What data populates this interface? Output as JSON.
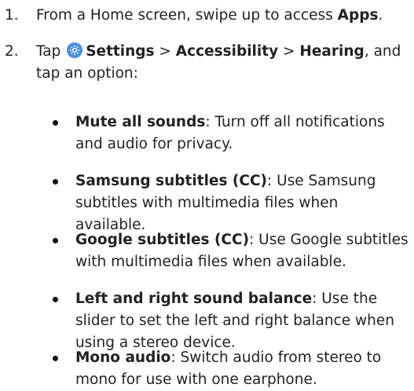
{
  "steps": [
    {
      "number": "1.",
      "prefix": "From a Home screen, swipe up to access ",
      "target": "Apps",
      "suffix": "."
    },
    {
      "number": "2.",
      "prefix": "Tap ",
      "settings": "Settings",
      "sep1": " > ",
      "accessibility": "Accessibility",
      "sep2": " > ",
      "hearing": "Hearing",
      "suffix": ", and tap an option:",
      "icon": "settings-gear-icon"
    }
  ],
  "options": [
    {
      "name": "Mute all sounds",
      "desc": ": Turn off all notifications and audio for privacy."
    },
    {
      "name": "Samsung subtitles (CC)",
      "desc": ": Use Samsung subtitles with multimedia files when available."
    },
    {
      "name": "Google subtitles (CC)",
      "desc": ": Use Google subtitles with multimedia files when available."
    },
    {
      "name": "Left and right sound balance",
      "desc": ": Use the slider to set the left and right balance when using a stereo device."
    },
    {
      "name": "Mono audio",
      "desc": ": Switch audio from stereo to mono for use with one earphone."
    }
  ],
  "colors": {
    "icon_bg": "#4b8fe0",
    "text": "#222222"
  }
}
